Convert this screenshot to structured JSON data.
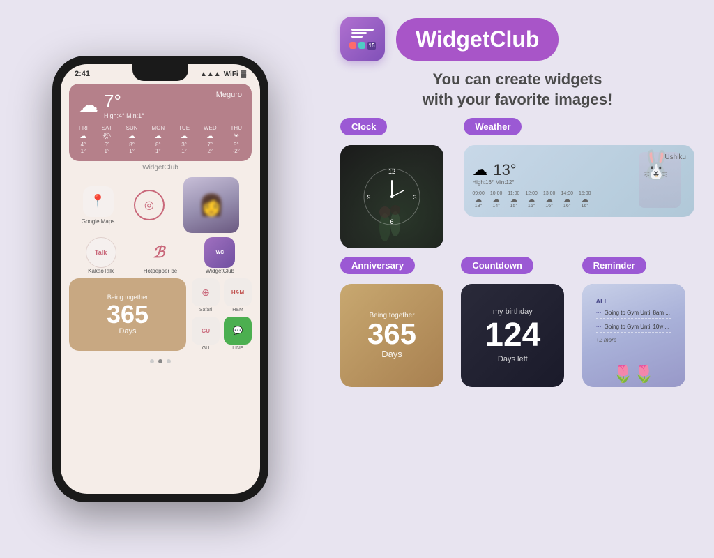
{
  "app": {
    "title": "WidgetClub",
    "tagline_line1": "You can create widgets",
    "tagline_line2": "with your favorite images!"
  },
  "phone": {
    "time": "2:41",
    "weather_widget": {
      "temp": "7°",
      "high_min": "High:4° Min:1°",
      "location": "Meguro",
      "forecast": [
        {
          "day": "FRI",
          "icon": "☁",
          "temps": "4°\n1°"
        },
        {
          "day": "SAT",
          "icon": "🌤",
          "temps": "6°\n1°"
        },
        {
          "day": "SUN",
          "icon": "☁",
          "temps": "8°\n1°"
        },
        {
          "day": "MON",
          "icon": "☁",
          "temps": "8°\n1°"
        },
        {
          "day": "TUE",
          "icon": "☁",
          "temps": "3°\n1°"
        },
        {
          "day": "WED",
          "icon": "☁",
          "temps": "7°\n2°"
        },
        {
          "day": "THU",
          "icon": "☀",
          "temps": "5°\n-2°"
        }
      ]
    },
    "widgetclub_label": "WidgetClub",
    "apps": [
      {
        "label": "Google Maps",
        "icon": "📍"
      },
      {
        "label": "KakaoTalk",
        "icon": "T"
      },
      {
        "label": "Hotpepper be",
        "icon": "B"
      },
      {
        "label": "WidgetClub",
        "icon": "WC"
      }
    ],
    "anniversary": {
      "being_together": "Being together",
      "days": "365",
      "days_label": "Days"
    },
    "small_icons": [
      {
        "label": "Safari",
        "icon": "⊕"
      },
      {
        "label": "H&M",
        "icon": "H&M"
      },
      {
        "label": "GU",
        "icon": "GU"
      },
      {
        "label": "LINE",
        "icon": "💬"
      }
    ]
  },
  "widgets": {
    "clock_badge": "Clock",
    "weather_badge": "Weather",
    "anniversary_badge": "Anniversary",
    "countdown_badge": "Countdown",
    "reminder_badge": "Reminder",
    "clock": {
      "numbers": [
        "12",
        "3",
        "6",
        "9"
      ]
    },
    "weather": {
      "location": "Ushiku",
      "temp": "13°",
      "high_min": "High:16° Min:12°",
      "times": [
        "09:00",
        "10:00",
        "11:00",
        "12:00",
        "13:00",
        "14:00",
        "15:00"
      ],
      "temps": [
        "13°",
        "14°",
        "15°",
        "16°",
        "16°",
        "16°",
        "16°"
      ]
    },
    "anniversary": {
      "being_together": "Being together",
      "days": "365",
      "days_label": "Days"
    },
    "countdown": {
      "event": "my birthday",
      "days": "124",
      "days_label": "Days left"
    },
    "reminder": {
      "badge": "ALL",
      "items": [
        "Going to Gym Until 8am ...",
        "Going to Gym Until 10w ..."
      ],
      "more": "+2 more"
    }
  }
}
